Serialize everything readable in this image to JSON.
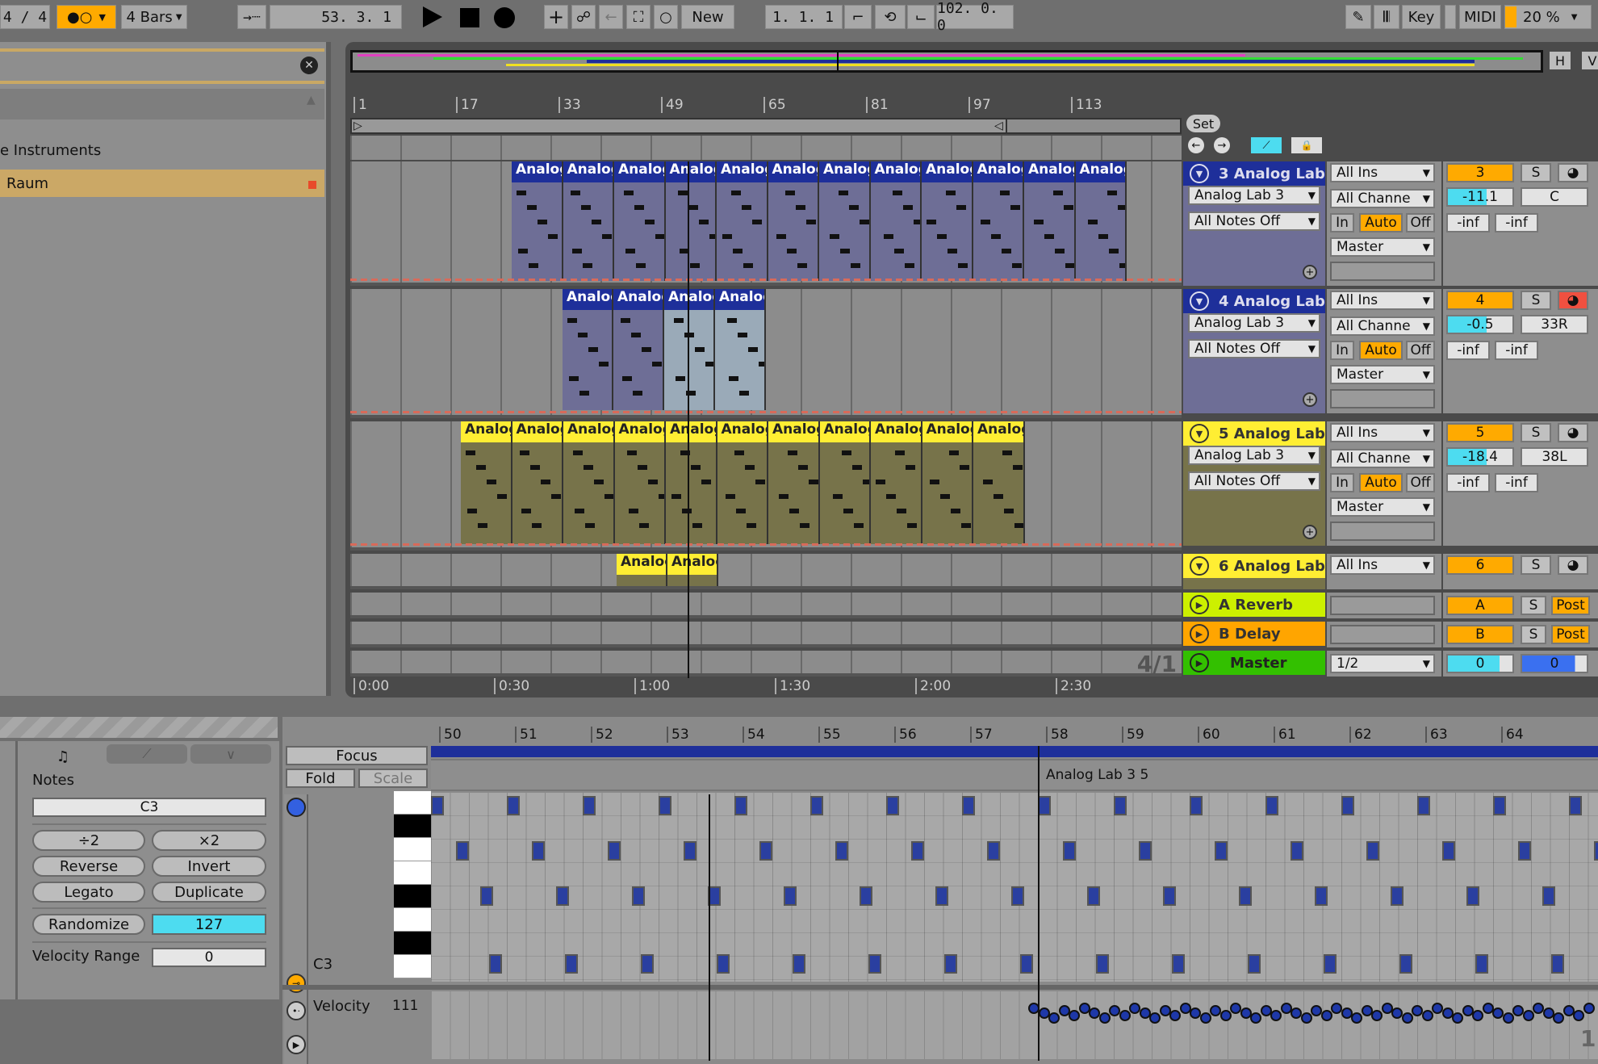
{
  "transport": {
    "time_signature": "4 / 4",
    "metronome": "●○",
    "quantize": "4 Bars",
    "follow_icon": "arrow-right-icon",
    "position": "53.  3.  1",
    "play_icon": "play-icon",
    "stop_icon": "stop-icon",
    "record_icon": "record-icon",
    "new_label": "New",
    "loop_start": "1.  1.  1",
    "loop_length": "102.  0.  0",
    "key_label": "Key",
    "midi_label": "MIDI",
    "cpu": "20 %",
    "h_label": "H",
    "w_label": "V"
  },
  "browser": {
    "items": [
      {
        "label": "e Instruments"
      },
      {
        "label": "Raum",
        "selected": true
      }
    ]
  },
  "ruler": {
    "bars": [
      "1",
      "17",
      "33",
      "49",
      "65",
      "81",
      "97",
      "113"
    ],
    "times": [
      "0:00",
      "0:30",
      "1:00",
      "1:30",
      "2:00",
      "2:30"
    ],
    "time_sig_overlay": "4/1",
    "set_label": "Set"
  },
  "tracks": [
    {
      "name": "3 Analog Lab",
      "color": "#1e2f9a",
      "clip_color": "#6e6e96",
      "device": "Analog Lab 3",
      "notes_off": "All Notes Off",
      "input": "All Ins",
      "channel": "All Channe",
      "monitor": [
        "In",
        "Auto",
        "Off"
      ],
      "output": "Master",
      "number": "3",
      "solo": "S",
      "volume": "-11.1",
      "pan": "C",
      "peak_l": "-inf",
      "peak_r": "-inf",
      "clip_label": "Analog",
      "clip_count": 12
    },
    {
      "name": "4 Analog Lab",
      "color": "#1e2f9a",
      "clip_color": "#6e6e96",
      "device": "Analog Lab 3",
      "notes_off": "All Notes Off",
      "input": "All Ins",
      "channel": "All Channe",
      "monitor": [
        "In",
        "Auto",
        "Off"
      ],
      "output": "Master",
      "number": "4",
      "solo": "S",
      "volume": "-0.5",
      "pan": "33R",
      "peak_l": "-inf",
      "peak_r": "-inf",
      "clip_label": "Analog",
      "clip_count": 4,
      "armed": true
    },
    {
      "name": "5 Analog Lab",
      "color": "#ffee33",
      "clip_color": "#77734a",
      "device": "Analog Lab 3",
      "notes_off": "All Notes Off",
      "input": "All Ins",
      "channel": "All Channe",
      "monitor": [
        "In",
        "Auto",
        "Off"
      ],
      "output": "Master",
      "number": "5",
      "solo": "S",
      "volume": "-18.4",
      "pan": "38L",
      "peak_l": "-inf",
      "peak_r": "-inf",
      "clip_label": "Analog",
      "clip_count": 11
    },
    {
      "name": "6 Analog Lab",
      "color": "#ffee33",
      "input": "All Ins",
      "number": "6",
      "solo": "S",
      "clip_label": "Analog",
      "clip_count": 2
    }
  ],
  "returns": [
    {
      "name": "A Reverb",
      "color": "#ccf000",
      "letter": "A",
      "solo": "S",
      "post": "Post"
    },
    {
      "name": "B Delay",
      "color": "#ffa500",
      "letter": "B",
      "solo": "S",
      "post": "Post"
    }
  ],
  "master": {
    "name": "Master",
    "color": "#33c000",
    "output": "1/2",
    "volume": "0",
    "pan": "0"
  },
  "clip_detail": {
    "notes_label": "Notes",
    "note_value": "C3",
    "buttons": [
      "÷2",
      "×2",
      "Reverse",
      "Invert",
      "Legato",
      "Duplicate"
    ],
    "randomize": "Randomize",
    "randomize_value": "127",
    "velocity_range_label": "Velocity Range",
    "velocity_range_value": "0"
  },
  "editor": {
    "focus": "Focus",
    "fold": "Fold",
    "scale": "Scale",
    "bars": [
      "50",
      "51",
      "52",
      "53",
      "54",
      "55",
      "56",
      "57",
      "58",
      "59",
      "60",
      "61",
      "62",
      "63",
      "64"
    ],
    "clip_name": "Analog Lab 3 5",
    "key_label": "C3",
    "velocity_label": "Velocity",
    "velocity_value": "111",
    "corner": "1"
  }
}
